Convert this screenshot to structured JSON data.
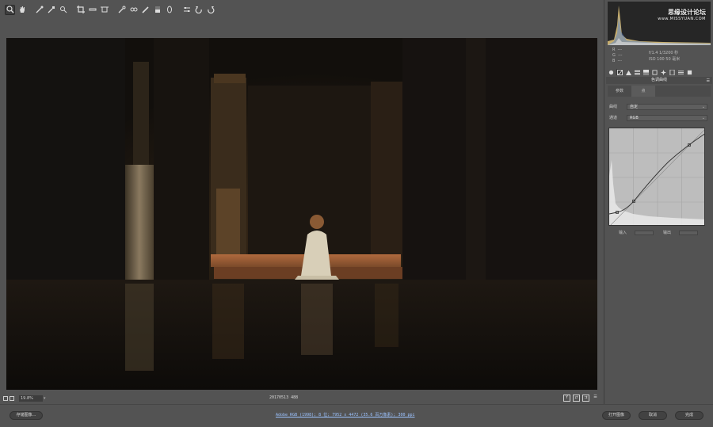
{
  "toolbar": {
    "tools": [
      "zoom-icon",
      "hand-icon",
      "white-balance-icon",
      "color-sampler-icon",
      "target-adjust-icon",
      "crop-icon",
      "straighten-icon",
      "transform-icon",
      "spot-removal-icon",
      "red-eye-icon",
      "adjustment-brush-icon",
      "graduated-filter-icon",
      "radial-filter-icon",
      "preferences-icon",
      "rotate-left-icon",
      "rotate-right-icon"
    ]
  },
  "canvas": {
    "zoom_value": "19.8%",
    "filename": "20170513 488"
  },
  "histogram": {
    "watermark_cn": "思缘设计论坛",
    "watermark_url": "www.MISSYUAN.COM"
  },
  "readout": {
    "r_label": "R",
    "g_label": "G",
    "b_label": "B",
    "r_value": "---",
    "g_value": "---",
    "b_value": "---",
    "exposure": "f/1.4  1/3200 秒",
    "iso": "ISO 100  50 毫米"
  },
  "panel": {
    "section_title": "色调曲线",
    "subtabs": [
      "参数",
      "点"
    ],
    "curve_label": "曲线",
    "curve_value": "自定",
    "channel_label": "通道",
    "channel_value": "RGB",
    "input_label": "输入",
    "output_label": "输出"
  },
  "footer": {
    "save_button": "存储图像...",
    "workflow_info": "Adobe RGB (1998); 8 位; 7952 x 4472 (35.6 百万像素); 300 ppi",
    "open_button": "打开图像",
    "cancel_button": "取消",
    "done_button": "完成"
  },
  "view": {
    "y_button": "Y"
  }
}
